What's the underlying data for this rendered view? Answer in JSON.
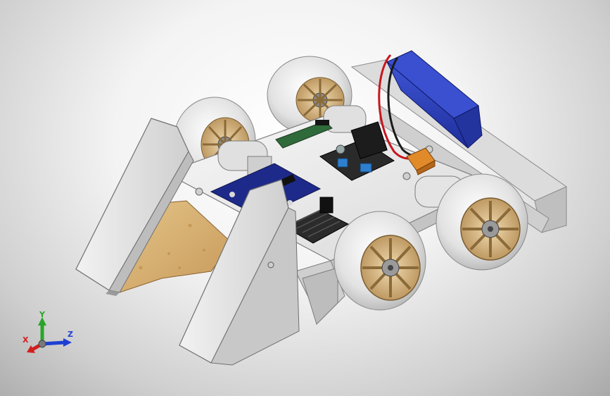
{
  "app": {
    "view": "isometric-3d-assembly"
  },
  "triad": {
    "x_label": "X",
    "y_label": "Y",
    "z_label": "Z",
    "x_color": "#d21f1f",
    "y_color": "#2aa52a",
    "z_color": "#1f3fd2"
  },
  "colors": {
    "chassis": "#e6e6e6",
    "wood_panel": "#d7b16c",
    "battery": "#2b3fbf",
    "controller_board": "#1e2a8a",
    "motor_driver": "#2a2a2a",
    "wheel_rim": "#c9a873",
    "wheel_tire": "#e4e4e4",
    "xt60_connector": "#e08a2a",
    "wire_red": "#c8161e",
    "wire_black": "#1a1a1a"
  }
}
